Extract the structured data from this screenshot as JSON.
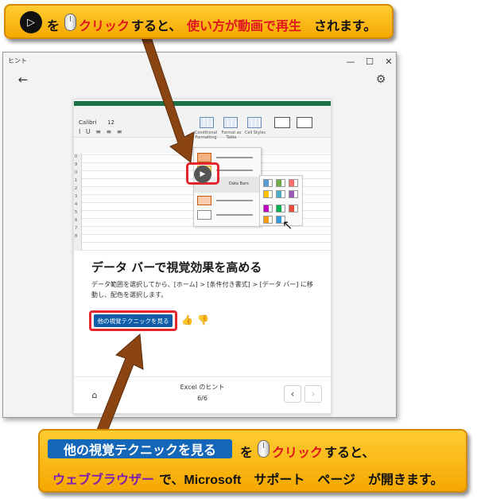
{
  "window": {
    "title": "ヒント",
    "minimize": "—",
    "maximize": "☐",
    "close": "✕",
    "back": "←",
    "settings": "⚙"
  },
  "video": {
    "font_name": "Calibri",
    "font_size": "12",
    "font_tools": "I U ≡ ≡ ≡",
    "ribbon_items": [
      "Conditional Formatting",
      "Format as Table",
      "Cell Styles"
    ],
    "row_numbers": [
      "0",
      "9",
      "0",
      "1",
      "2",
      "3",
      "4",
      "5",
      "6",
      "7",
      "8"
    ],
    "submenu_label": "Data Bars",
    "play": "▶",
    "cursor": "↖"
  },
  "tip": {
    "title": "データ バーで視覚効果を高める",
    "description": "データ範囲を選択してから、[ホーム] > [条件付き書式] > [データ バー] に移動し、配色を選択します。",
    "see_more": "他の視覚テクニックを見る",
    "thumbs_up": "👍",
    "thumbs_down": "👎"
  },
  "footer": {
    "home": "⌂",
    "title": "Excel のヒント",
    "count": "6/6",
    "prev": "‹",
    "next": "›"
  },
  "callout_top": {
    "play": "▷",
    "part1": "を",
    "part2": "クリック",
    "part3": "すると、",
    "part4": "使い方が動画で再生",
    "part5": "されます。"
  },
  "callout_bottom": {
    "badge": "他の視覚テクニックを見る",
    "part1": "を",
    "part2": "クリック",
    "part3": "すると、",
    "line2_a": "ウェブブラウザー",
    "line2_b": "で、Microsoft　サポート　ページ　が開きます。"
  },
  "colors": {
    "accent_red": "#e5262d",
    "callout_orange": "#f5a800",
    "button_blue": "#0f5da8",
    "excel_green": "#1e7145",
    "arrow_brown": "#8b4513"
  }
}
